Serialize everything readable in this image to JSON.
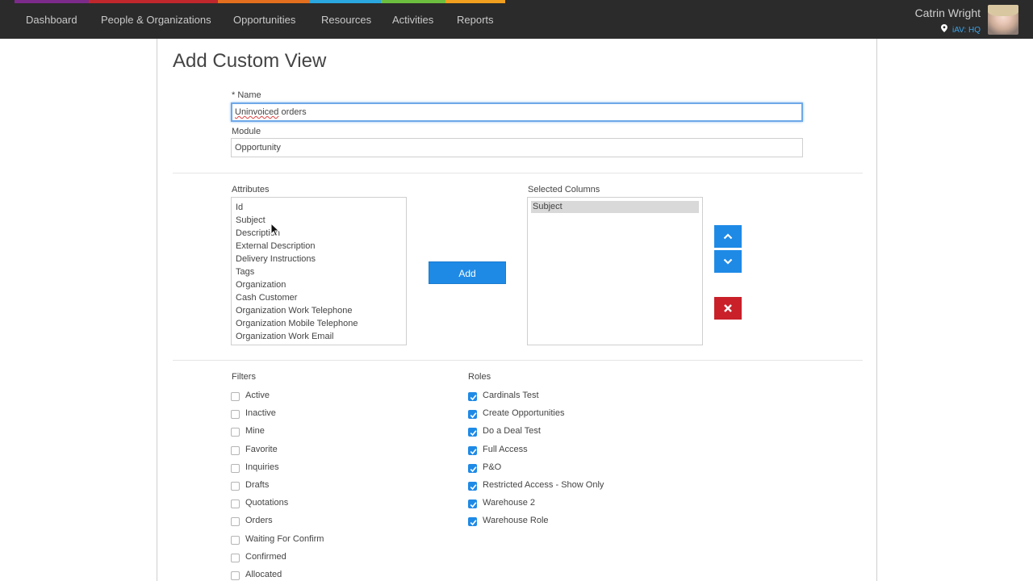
{
  "nav": {
    "items": [
      "Dashboard",
      "People & Organizations",
      "Opportunities",
      "Resources",
      "Activities",
      "Reports"
    ],
    "stripe_colors": [
      "#7d2b8b",
      "#c0272d",
      "#e36f1e",
      "#2aa7df",
      "#6cbf3e",
      "#f0a01e"
    ]
  },
  "user": {
    "name": "Catrin Wright",
    "location": "iAV: HQ",
    "location_icon": "map-pin-icon"
  },
  "page": {
    "title": "Add Custom View"
  },
  "form": {
    "name_label": "* Name",
    "name_value": "Uninvoiced orders",
    "name_value_misspelled": "Uninvoiced",
    "name_value_rest": " orders",
    "module_label": "Module",
    "module_value": "Opportunity"
  },
  "attributes": {
    "label": "Attributes",
    "items": [
      "Id",
      "Subject",
      "Description",
      "External Description",
      "Delivery Instructions",
      "Tags",
      "Organization",
      "Cash Customer",
      "Organization Work Telephone",
      "Organization Mobile Telephone",
      "Organization Work Email"
    ]
  },
  "add_button": "Add",
  "selected_columns": {
    "label": "Selected Columns",
    "items": [
      "Subject"
    ]
  },
  "filters": {
    "label": "Filters",
    "items": [
      {
        "label": "Active",
        "checked": false
      },
      {
        "label": "Inactive",
        "checked": false
      },
      {
        "label": "Mine",
        "checked": false
      },
      {
        "label": "Favorite",
        "checked": false
      },
      {
        "label": "Inquiries",
        "checked": false
      },
      {
        "label": "Drafts",
        "checked": false
      },
      {
        "label": "Quotations",
        "checked": false
      },
      {
        "label": "Orders",
        "checked": false
      },
      {
        "label": "Waiting For Confirm",
        "checked": false
      },
      {
        "label": "Confirmed",
        "checked": false
      },
      {
        "label": "Allocated",
        "checked": false
      }
    ]
  },
  "roles": {
    "label": "Roles",
    "items": [
      {
        "label": "Cardinals Test",
        "checked": true
      },
      {
        "label": "Create Opportunities",
        "checked": true
      },
      {
        "label": "Do a Deal Test",
        "checked": true
      },
      {
        "label": "Full Access",
        "checked": true
      },
      {
        "label": "P&O",
        "checked": true
      },
      {
        "label": "Restricted Access - Show Only",
        "checked": true
      },
      {
        "label": "Warehouse 2",
        "checked": true
      },
      {
        "label": "Warehouse Role",
        "checked": true
      }
    ]
  },
  "colors": {
    "nav_bg": "#2b2b2b",
    "accent_blue": "#1e8ae6",
    "danger_red": "#c9202a",
    "location_blue": "#3ba3e8"
  }
}
